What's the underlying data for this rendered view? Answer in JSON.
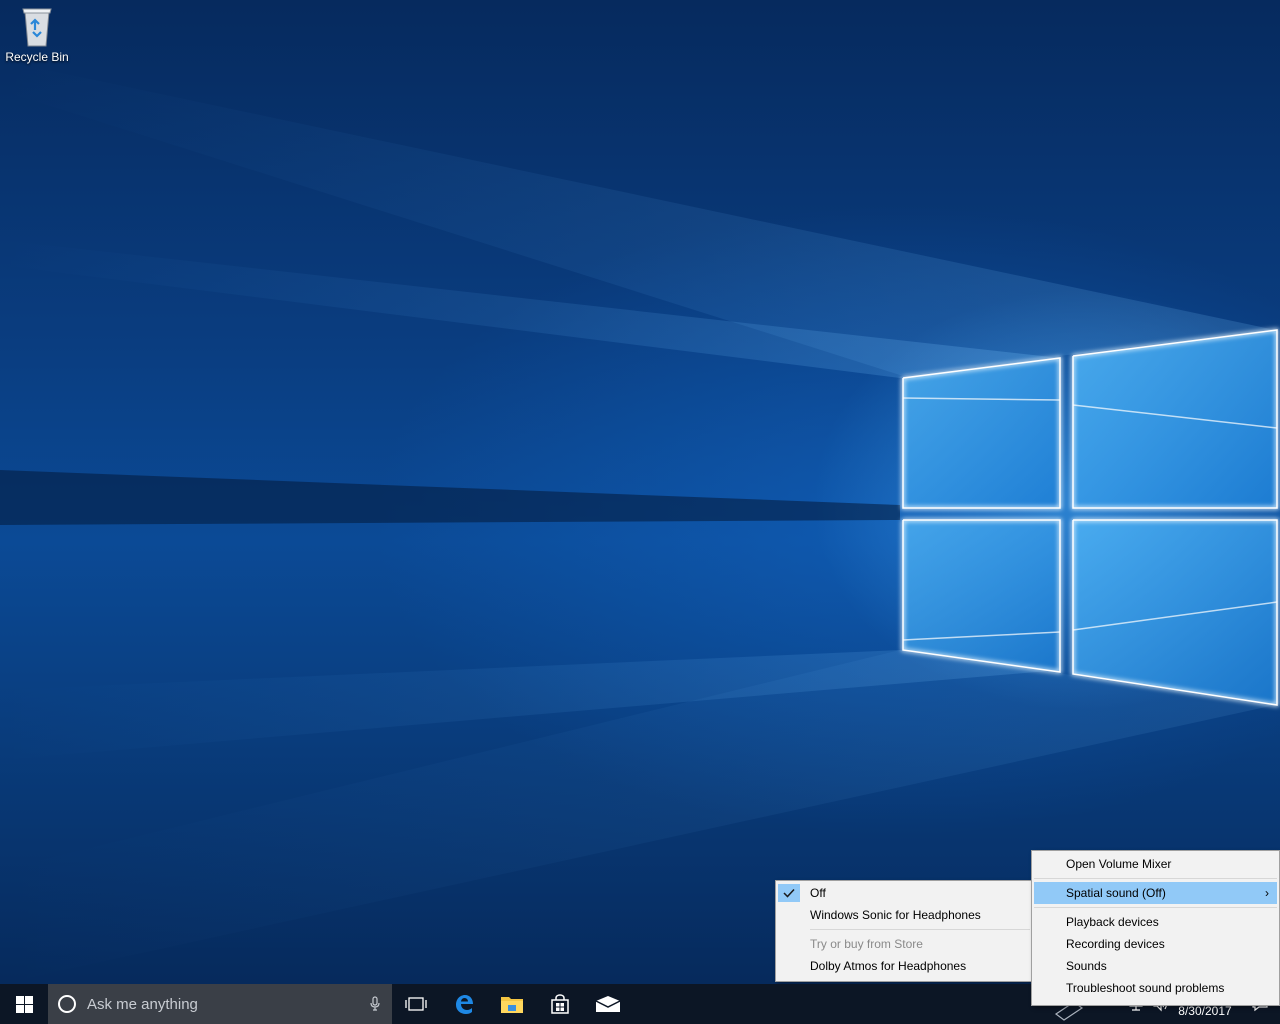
{
  "desktop": {
    "icons": [
      {
        "label": "Recycle Bin",
        "icon": "recycle-bin-icon"
      }
    ]
  },
  "taskbar": {
    "start_icon": "windows-logo-icon",
    "search": {
      "placeholder": "Ask me anything",
      "icon": "cortana-circle-icon",
      "mic_icon": "microphone-icon"
    },
    "pinned": [
      {
        "name": "task-view",
        "icon": "task-view-icon"
      },
      {
        "name": "edge",
        "icon": "edge-icon"
      },
      {
        "name": "file-explorer",
        "icon": "folder-icon"
      },
      {
        "name": "store",
        "icon": "store-bag-icon"
      },
      {
        "name": "mail",
        "icon": "mail-icon"
      }
    ],
    "tray": {
      "date": "8/30/2017",
      "notification_icon": "action-center-icon"
    }
  },
  "volume_menu": {
    "items": [
      {
        "label": "Open Volume Mixer"
      },
      {
        "label": "Spatial sound (Off)",
        "submenu_arrow": "›",
        "highlighted": true
      },
      {
        "label": "Playback devices"
      },
      {
        "label": "Recording devices"
      },
      {
        "label": "Sounds"
      },
      {
        "label": "Troubleshoot sound problems"
      }
    ]
  },
  "spatial_submenu": {
    "items": [
      {
        "label": "Off",
        "checked": true
      },
      {
        "label": "Windows Sonic for Headphones"
      },
      {
        "label": "Try or buy from Store",
        "disabled": true
      },
      {
        "label": "Dolby Atmos for Headphones"
      }
    ]
  },
  "colors": {
    "menu_highlight": "#91c9f7",
    "taskbar": "#0c1625",
    "accent": "#0078d7"
  }
}
